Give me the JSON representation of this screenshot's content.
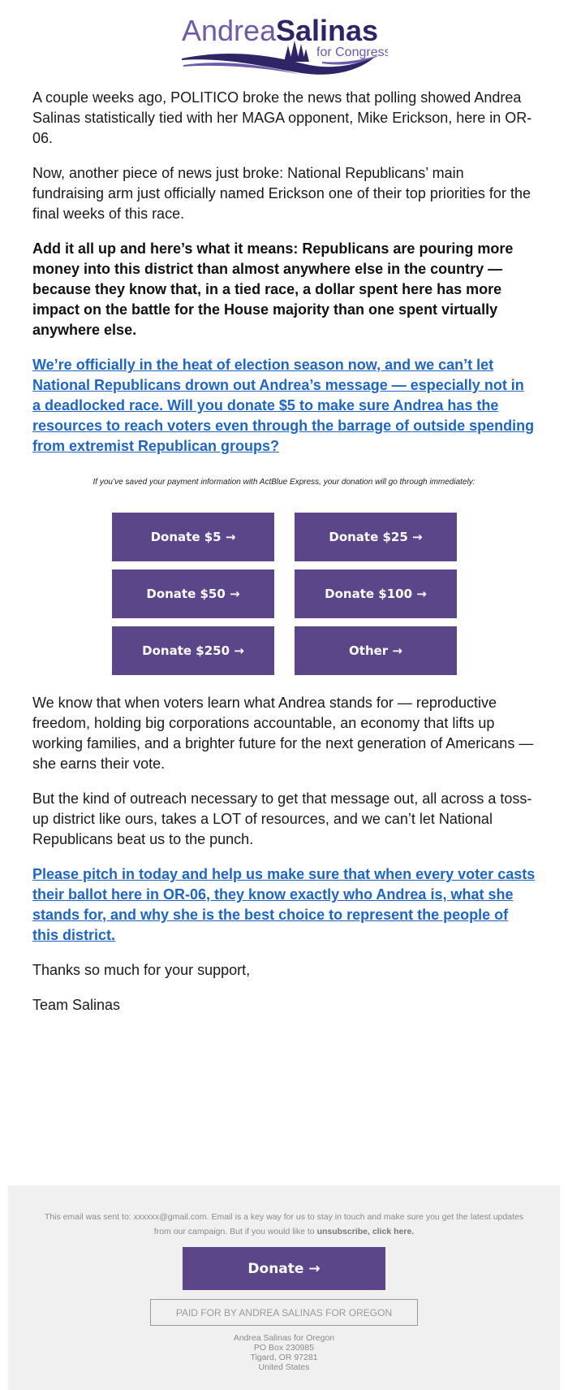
{
  "logo": {
    "first_name": "Andrea",
    "last_name": "Salinas",
    "tagline": "for Congress",
    "colors": {
      "light": "#6e5aa8",
      "dark": "#2f2566"
    }
  },
  "body": {
    "paragraphs_top": [
      {
        "style": "normal",
        "text": "A couple weeks ago, POLITICO broke the news that polling showed Andrea Salinas statistically tied with her MAGA opponent, Mike Erickson, here in OR-06."
      },
      {
        "style": "normal",
        "text": "Now, another piece of news just broke: National Republicans’ main fundraising arm just officially named Erickson one of their top priorities for the final weeks of this race."
      },
      {
        "style": "bold",
        "text": "Add it all up and here’s what it means: Republicans are pouring more money into this district than almost anywhere else in the country — because they know that, in a tied race, a dollar spent here has more impact on the battle for the House majority than one spent virtually anywhere else."
      },
      {
        "style": "link",
        "text": "We’re officially in the heat of election season now, and we can’t let National Republicans drown out Andrea’s message — especially not in a deadlocked race. Will you donate $5 to make sure Andrea has the resources to reach voters even through the barrage of outside spending from extremist Republican groups?"
      }
    ],
    "actblue_note": "If you’ve saved your payment information with ActBlue Express, your donation will go through immediately:",
    "donate_buttons": [
      "Donate $5 →",
      "Donate $25 →",
      "Donate $50 →",
      "Donate $100 →",
      "Donate $250 →",
      "Other →"
    ],
    "paragraphs_bottom": [
      {
        "style": "normal",
        "text": "We know that when voters learn what Andrea stands for — reproductive freedom, holding big corporations accountable, an economy that lifts up working families, and a brighter future for the next generation of Americans — she earns their vote."
      },
      {
        "style": "normal",
        "text": "But the kind of outreach necessary to get that message out, all across a toss-up district like ours, takes a LOT of resources, and we can’t let National Republicans beat us to the punch."
      },
      {
        "style": "link",
        "text": "Please pitch in today and help us make sure that when every voter casts their ballot here in OR-06, they know exactly who Andrea is, what she stands for, and why she is the best choice to represent the people of this district."
      },
      {
        "style": "normal",
        "text": "Thanks so much for your support,"
      },
      {
        "style": "normal",
        "text": "Team Salinas"
      }
    ]
  },
  "footer": {
    "sent_to_text": "This email was sent to: xxxxxx@gmail.com. Email is a key way for us to stay in touch and make sure you get the latest updates from our campaign. But if you would like to ",
    "unsubscribe_label": "unsubscribe, click here.",
    "donate_label": "Donate →",
    "paid_for": "PAID FOR BY ANDREA SALINAS FOR OREGON",
    "address": {
      "org": "Andrea Salinas for Oregon",
      "line1": "PO Box 230985",
      "line2": "Tigard, OR 97281",
      "country": "United States"
    }
  },
  "colors": {
    "button": "#5a4689",
    "link": "#1f66c1",
    "footer_bg": "#f0f0f0",
    "footer_text": "#8a8a8a"
  }
}
